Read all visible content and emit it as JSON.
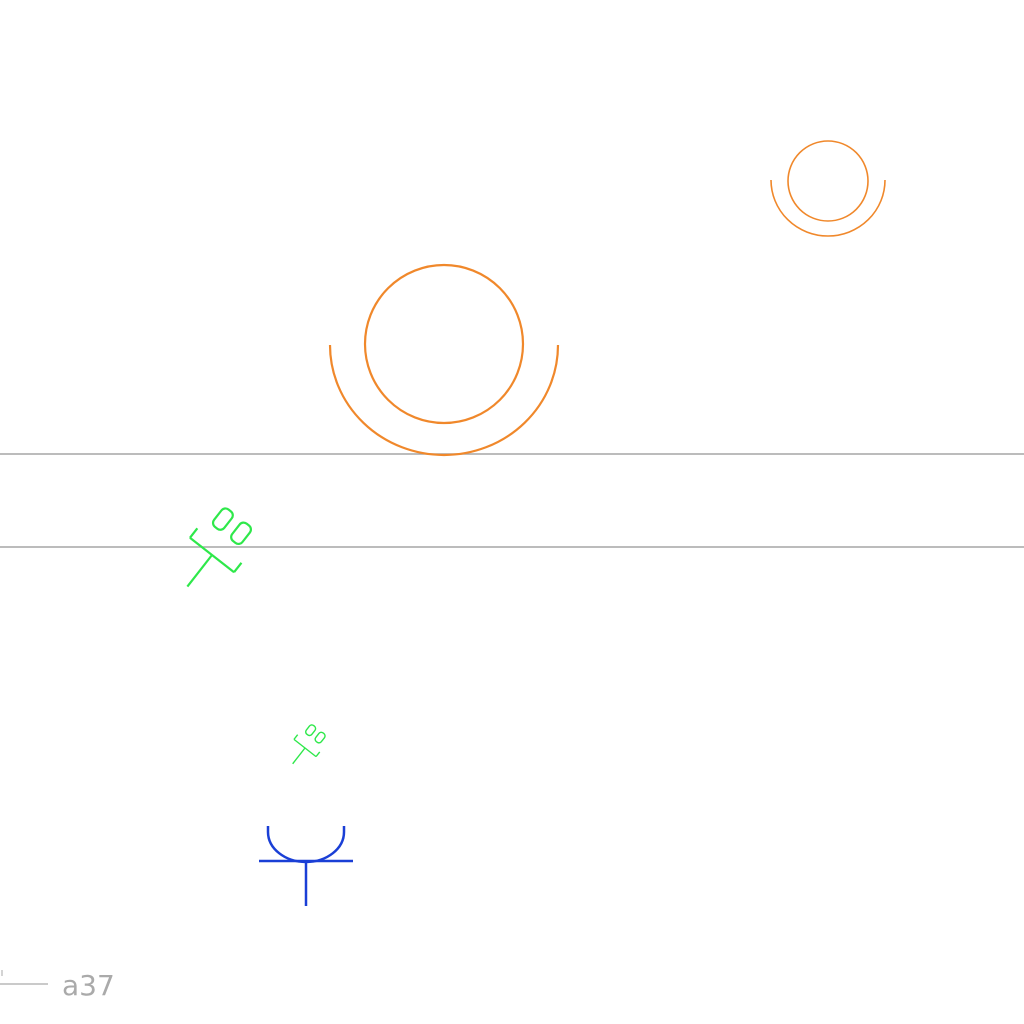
{
  "colors": {
    "background": "#ffffff",
    "wall_line": "#a6a6a6",
    "orange_symbol": "#f0882b",
    "green_symbol": "#2ee84a",
    "blue_symbol": "#1a3fd6",
    "tag": "#aaaaaa"
  },
  "symbols": [
    {
      "name": "large-double-circle-icon",
      "kind": "double-circle",
      "color_key": "orange_symbol"
    },
    {
      "name": "small-double-circle-icon",
      "kind": "double-circle",
      "color_key": "orange_symbol"
    },
    {
      "name": "large-plug-icon",
      "kind": "plug",
      "color_key": "green_symbol"
    },
    {
      "name": "small-plug-icon",
      "kind": "plug",
      "color_key": "green_symbol"
    },
    {
      "name": "antenna-icon",
      "kind": "antenna",
      "color_key": "blue_symbol"
    }
  ],
  "tag": {
    "label": "a37"
  }
}
